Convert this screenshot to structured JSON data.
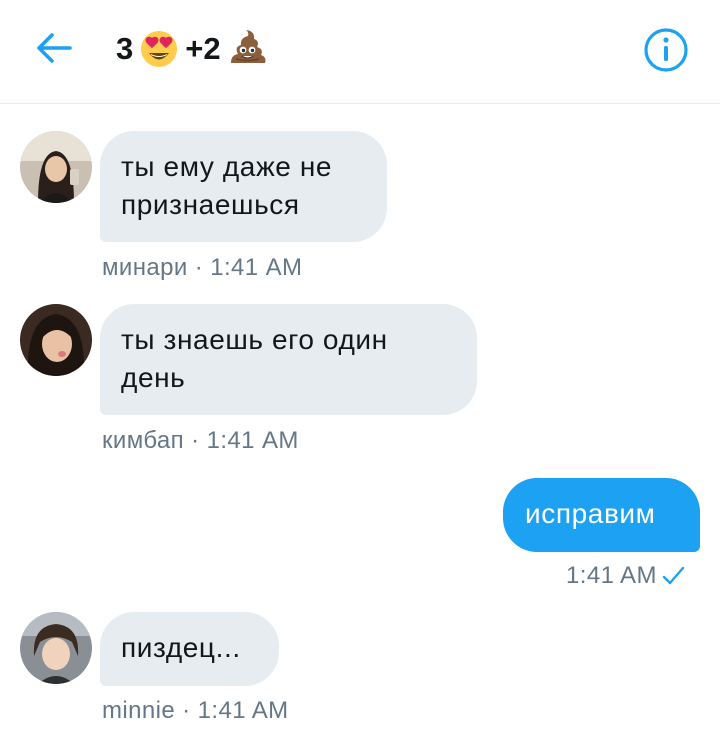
{
  "header": {
    "title_part1": "3",
    "title_part2": "+2",
    "back_icon": "arrow-left-icon",
    "info_icon": "info-circle-icon",
    "accent_color": "#1da1f2"
  },
  "messages": [
    {
      "sender": "минари",
      "text": "ты ему даже не признаешься",
      "time": "1:41 AM",
      "direction": "incoming"
    },
    {
      "sender": "кимбап",
      "text": "ты знаешь его один день",
      "time": "1:41 AM",
      "direction": "incoming"
    },
    {
      "text": "исправим",
      "time": "1:41 AM",
      "direction": "outgoing",
      "status_icon": "check-icon"
    },
    {
      "sender": "minnie",
      "text": "пиздец...",
      "time": "1:41 AM",
      "direction": "incoming"
    }
  ],
  "separator": " · ",
  "colors": {
    "incoming_bubble": "#e6ecf0",
    "outgoing_bubble": "#1da1f2",
    "meta_text": "#657786"
  }
}
